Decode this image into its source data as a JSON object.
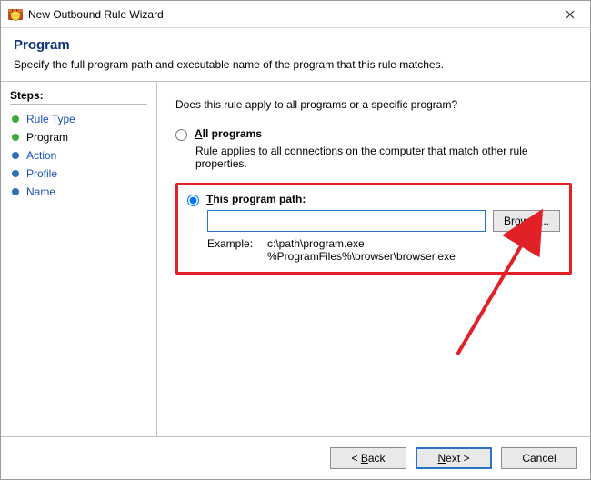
{
  "window": {
    "title": "New Outbound Rule Wizard"
  },
  "header": {
    "title": "Program",
    "description": "Specify the full program path and executable name of the program that this rule matches."
  },
  "sidebar": {
    "title": "Steps:",
    "items": [
      {
        "label": "Rule Type"
      },
      {
        "label": "Program"
      },
      {
        "label": "Action"
      },
      {
        "label": "Profile"
      },
      {
        "label": "Name"
      }
    ]
  },
  "main": {
    "prompt": "Does this rule apply to all programs or a specific program?",
    "all_programs": {
      "prefix": "A",
      "rest": "ll programs",
      "desc": "Rule applies to all connections on the computer that match other rule properties."
    },
    "this_program": {
      "prefix": "T",
      "rest": "his program path:",
      "value": "",
      "browse_prefix": "B",
      "browse_rest": "rowse...",
      "example_label": "Example:",
      "example_paths": "c:\\path\\program.exe\n%ProgramFiles%\\browser\\browser.exe"
    }
  },
  "footer": {
    "back_prefix": "B",
    "back_rest": "ack",
    "next_prefix": "N",
    "next_rest": "ext",
    "cancel": "Cancel"
  }
}
